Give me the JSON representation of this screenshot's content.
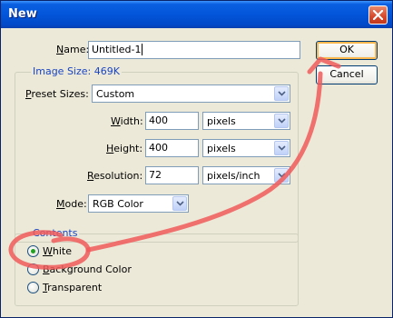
{
  "window": {
    "title": "New",
    "close_icon": "close-icon"
  },
  "name_field": {
    "label_key": "N",
    "label_rest": "ame:",
    "value": "Untitled-1"
  },
  "image_size": {
    "label": "Image Size:",
    "value": "469K"
  },
  "preset": {
    "label_key": "P",
    "label_rest": "reset Sizes:",
    "value": "Custom"
  },
  "width": {
    "label_key": "W",
    "label_rest": "idth:",
    "value": "400",
    "unit": "pixels"
  },
  "height": {
    "label_key": "H",
    "label_rest": "eight:",
    "value": "400",
    "unit": "pixels"
  },
  "resolution": {
    "label_key": "R",
    "label_rest": "esolution:",
    "value": "72",
    "unit": "pixels/inch"
  },
  "mode": {
    "label_key": "M",
    "label_rest": "ode:",
    "value": "RGB Color"
  },
  "contents": {
    "legend": "Contents",
    "options": [
      {
        "key": "W",
        "rest": "hite",
        "selected": true
      },
      {
        "key": "B",
        "rest": "ackground Color",
        "selected": false
      },
      {
        "key": "T",
        "rest": "ransparent",
        "selected": false
      }
    ]
  },
  "buttons": {
    "ok": "OK",
    "cancel": "Cancel"
  },
  "colors": {
    "title_bar": "#0355d9",
    "group_label": "#1a45c4",
    "annotation_red": "#f05a5a",
    "dialog_bg": "#ece9d8"
  }
}
